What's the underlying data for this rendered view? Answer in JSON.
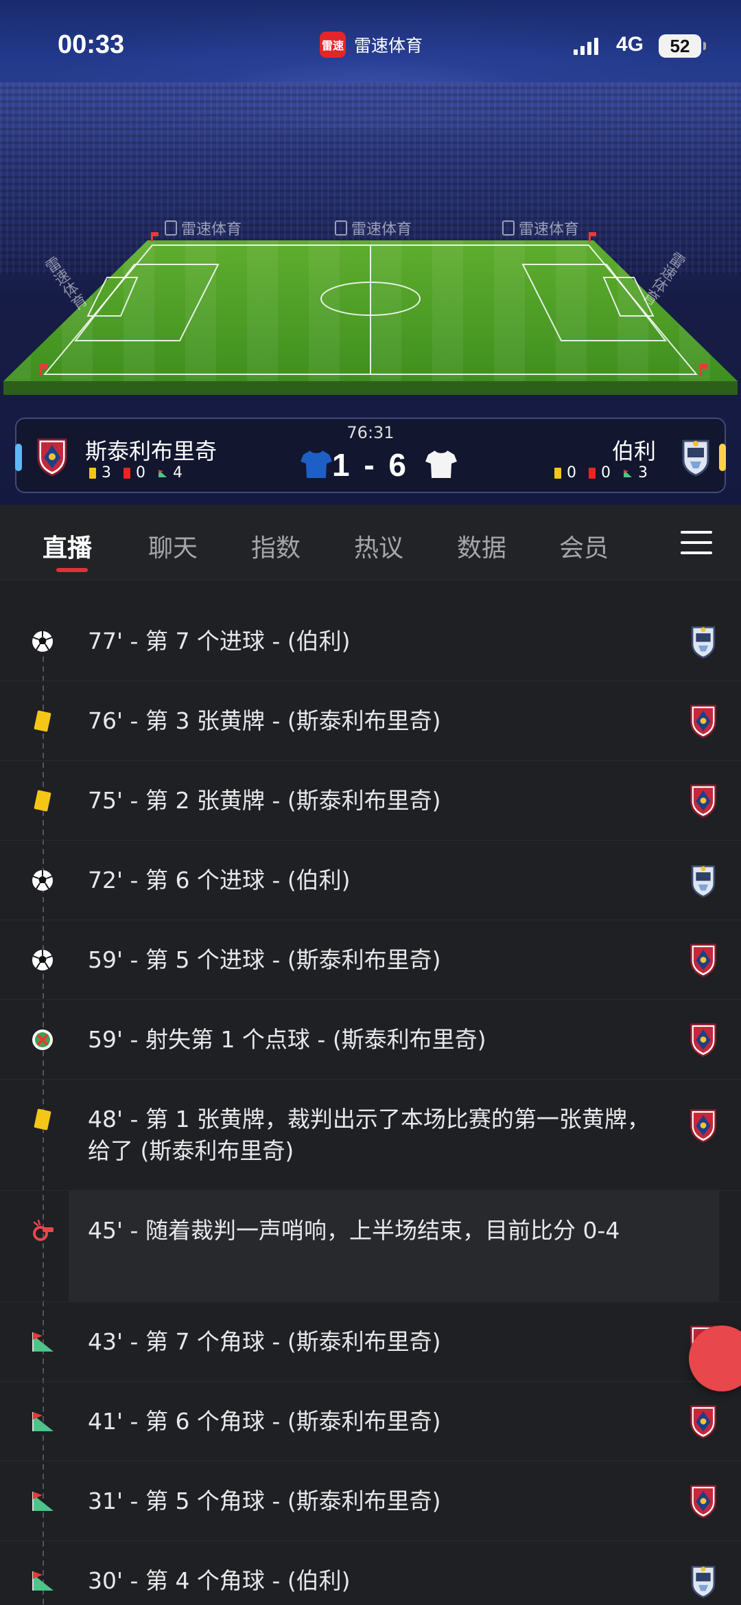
{
  "status_bar": {
    "time": "00:33",
    "app_name": "雷速体育",
    "app_logo_text": "雷速",
    "network": "4G",
    "battery": "52"
  },
  "stadium": {
    "ad_text": "雷速体育"
  },
  "match": {
    "clock": "76:31",
    "score": "1 - 6",
    "home": {
      "name": "斯泰利布里奇",
      "yellow": "3",
      "red": "0",
      "corners": "4",
      "edge_color": "#5fb8f5"
    },
    "away": {
      "name": "伯利",
      "yellow": "0",
      "red": "0",
      "corners": "3",
      "edge_color": "#ffd24a"
    }
  },
  "tabs": [
    {
      "label": "直播",
      "active": true
    },
    {
      "label": "聊天",
      "active": false
    },
    {
      "label": "指数",
      "active": false
    },
    {
      "label": "热议",
      "active": false
    },
    {
      "label": "数据",
      "active": false
    },
    {
      "label": "会员",
      "active": false
    }
  ],
  "events": [
    {
      "icon": "goal",
      "text": "77' - 第 7 个进球 - (伯利)",
      "team": "away"
    },
    {
      "icon": "yellow-card",
      "text": "76' - 第 3 张黄牌 - (斯泰利布里奇)",
      "team": "home"
    },
    {
      "icon": "yellow-card",
      "text": "75' - 第 2 张黄牌 - (斯泰利布里奇)",
      "team": "home"
    },
    {
      "icon": "goal",
      "text": "72' - 第 6 个进球 - (伯利)",
      "team": "away"
    },
    {
      "icon": "goal",
      "text": "59' - 第 5 个进球 - (斯泰利布里奇)",
      "team": "home"
    },
    {
      "icon": "penalty-miss",
      "text": "59' - 射失第 1 个点球 - (斯泰利布里奇)",
      "team": "home"
    },
    {
      "icon": "yellow-card",
      "text": "48' - 第 1 张黄牌，裁判出示了本场比赛的第一张黄牌，给了 (斯泰利布里奇)",
      "team": "home"
    },
    {
      "icon": "whistle",
      "text": "45' - 随着裁判一声哨响，上半场结束，目前比分 0-4",
      "team": ""
    },
    {
      "icon": "corner-flag",
      "text": "43' - 第 7 个角球 - (斯泰利布里奇)",
      "team": "home"
    },
    {
      "icon": "corner-flag",
      "text": "41' - 第 6 个角球 - (斯泰利布里奇)",
      "team": "home"
    },
    {
      "icon": "corner-flag",
      "text": "31' - 第 5 个角球 - (斯泰利布里奇)",
      "team": "home"
    },
    {
      "icon": "corner-flag",
      "text": "30' - 第 4 个角球 - (伯利)",
      "team": "away"
    }
  ]
}
